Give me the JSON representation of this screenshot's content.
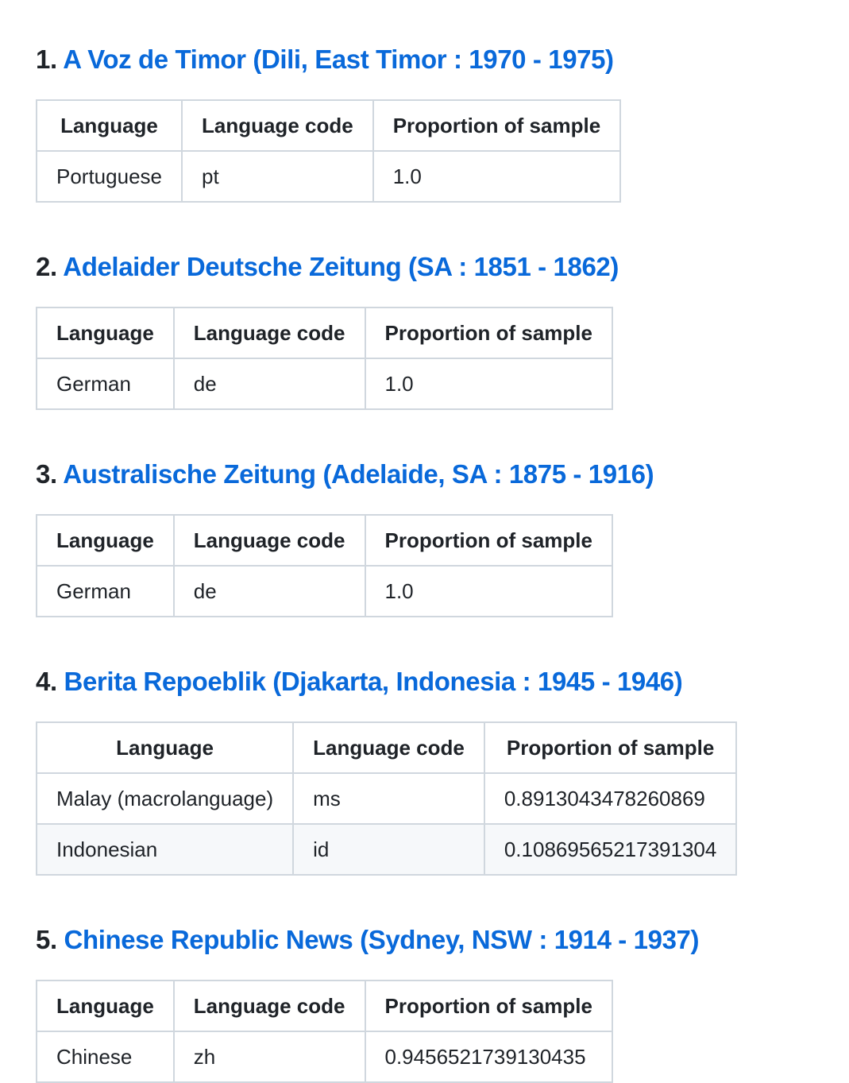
{
  "headers": [
    "Language",
    "Language code",
    "Proportion of sample"
  ],
  "sections": [
    {
      "number": "1.",
      "title": "A Voz de Timor (Dili, East Timor : 1970 - 1975)",
      "rows": [
        [
          "Portuguese",
          "pt",
          "1.0"
        ]
      ]
    },
    {
      "number": "2.",
      "title": "Adelaider Deutsche Zeitung (SA : 1851 - 1862)",
      "rows": [
        [
          "German",
          "de",
          "1.0"
        ]
      ]
    },
    {
      "number": "3.",
      "title": "Australische Zeitung (Adelaide, SA : 1875 - 1916)",
      "rows": [
        [
          "German",
          "de",
          "1.0"
        ]
      ]
    },
    {
      "number": "4.",
      "title": "Berita Repoeblik (Djakarta, Indonesia : 1945 - 1946)",
      "rows": [
        [
          "Malay (macrolanguage)",
          "ms",
          "0.8913043478260869"
        ],
        [
          "Indonesian",
          "id",
          "0.10869565217391304"
        ]
      ]
    },
    {
      "number": "5.",
      "title": "Chinese Republic News (Sydney, NSW : 1914 - 1937)",
      "rows": [
        [
          "Chinese",
          "zh",
          "0.9456521739130435"
        ]
      ]
    }
  ],
  "colors": {
    "link": "#0969da",
    "text": "#1f2328",
    "border": "#d0d7de",
    "stripe": "#f6f8fa"
  }
}
